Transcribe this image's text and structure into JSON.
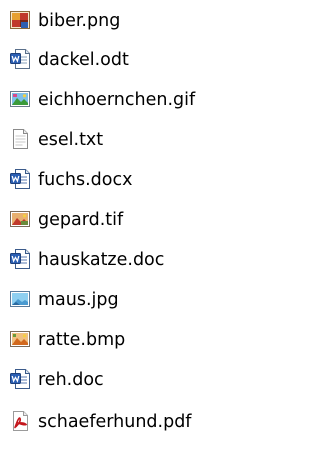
{
  "files": [
    {
      "name": "biber.png",
      "icon": "png-image-icon"
    },
    {
      "name": "dackel.odt",
      "icon": "odt-document-icon"
    },
    {
      "name": "eichhoernchen.gif",
      "icon": "gif-image-icon"
    },
    {
      "name": "esel.txt",
      "icon": "text-file-icon"
    },
    {
      "name": "fuchs.docx",
      "icon": "word-document-icon"
    },
    {
      "name": "gepard.tif",
      "icon": "tif-image-icon"
    },
    {
      "name": "hauskatze.doc",
      "icon": "word-document-icon"
    },
    {
      "name": "maus.jpg",
      "icon": "jpg-image-icon"
    },
    {
      "name": "ratte.bmp",
      "icon": "bmp-image-icon"
    },
    {
      "name": "reh.doc",
      "icon": "word-document-icon"
    },
    {
      "name": "schaeferhund.pdf",
      "icon": "pdf-document-icon"
    }
  ],
  "colors": {
    "word_blue": "#2b5fb4",
    "pdf_red": "#c4161c",
    "text": "#000000"
  }
}
